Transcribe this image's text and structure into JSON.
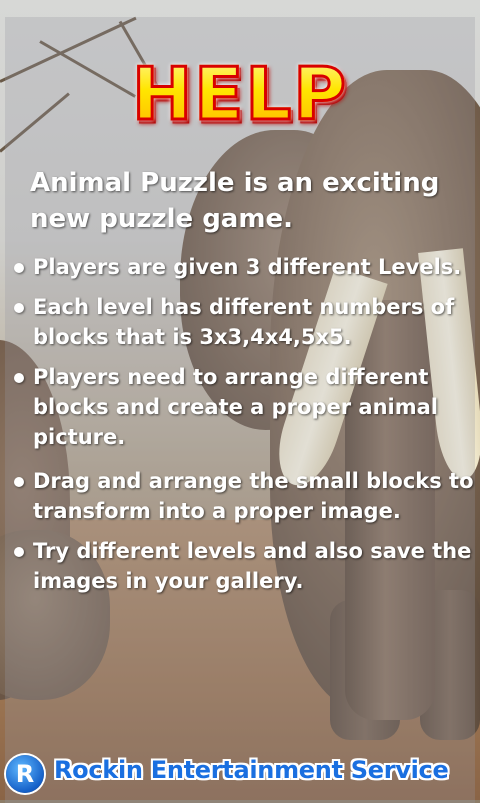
{
  "screen": {
    "title": "HELP",
    "intro": "Animal Puzzle is an exciting new puzzle game.",
    "bullets": [
      "Players are given 3 different Levels.",
      "Each level has different numbers of blocks that is 3x3,4x4,5x5.",
      "Players need to arrange different blocks and create a proper animal picture.",
      "Drag and arrange the small blocks to transform into a proper image.",
      "Try different levels and also save the images in your gallery."
    ]
  },
  "footer": {
    "logo_letter": "R",
    "company": "Rockin Entertainment Service"
  },
  "colors": {
    "title_fill": "#ffe600",
    "title_outline": "#d80000",
    "text": "#ffffff",
    "company_text": "#1a6fe0"
  },
  "icons": {
    "logo": "rockin-logo-icon",
    "bullet": "bullet-dot-icon"
  }
}
